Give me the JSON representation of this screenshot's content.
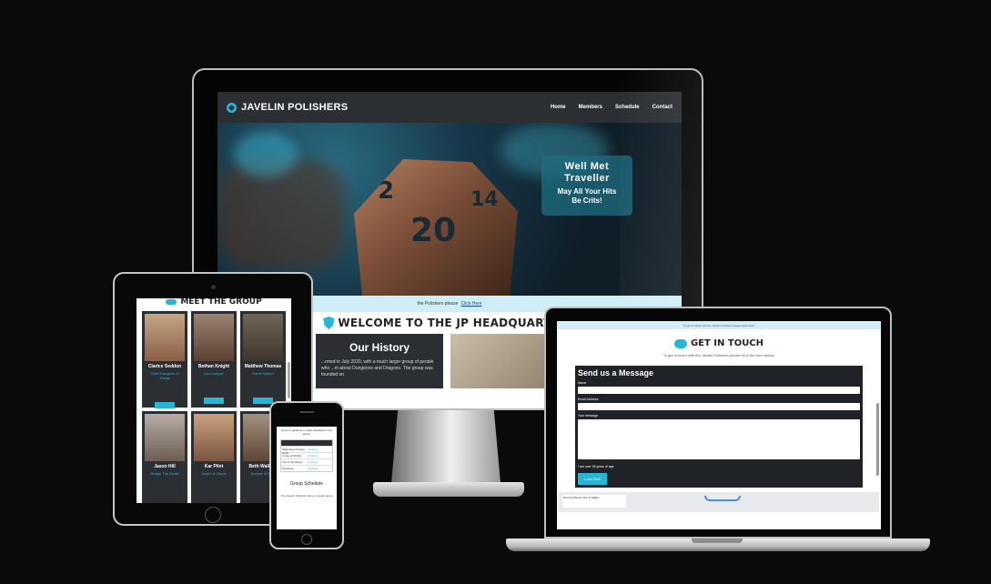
{
  "desktop": {
    "brand": "JAVELIN POLISHERS",
    "nav": [
      "Home",
      "Members",
      "Schedule",
      "Contact"
    ],
    "hero": {
      "dice_numbers": [
        "2",
        "20",
        "14"
      ],
      "callout_line1": "Well Met",
      "callout_line2": "Traveller",
      "callout_line3": "May All Your Hits",
      "callout_line4": "Be Crits!"
    },
    "info_bar": {
      "text": "the Polishers please",
      "link": "Click Here"
    },
    "welcome_title": "WELCOME TO THE JP HEADQUARTERS",
    "history": {
      "title": "Our History",
      "text": "...rmed in July 2020, with a much larger group of people who ...m about Dungeons and Dragons. The group was founded on"
    }
  },
  "tablet": {
    "title": "MEET THE GROUP",
    "members": [
      {
        "name": "Clarice Seddon",
        "role": "Chief Dungeon of Things"
      },
      {
        "name": "Bethan Knight",
        "role": "Lore Keeper"
      },
      {
        "name": "Matthew Thomas",
        "role": "Game Master"
      },
      {
        "name": "Jason Hill",
        "role": "Rogue The Beast"
      },
      {
        "name": "Kar Pilot",
        "role": "Squid of Chaos"
      },
      {
        "name": "Beth Wallace",
        "role": "Keeper of Dice"
      }
    ]
  },
  "phone": {
    "intro": "Here's a guide as to what schedule for the group.",
    "rows": [
      {
        "campaign": "Waterdeep Dragon Heist",
        "status": "Ongoing"
      },
      {
        "campaign": "Curse of Strahd",
        "status": "Ongoing"
      },
      {
        "campaign": "Out of the Abyss",
        "status": "Ongoing"
      },
      {
        "campaign": "Oneshots",
        "status": "Ongoing"
      }
    ],
    "schedule_title": "Group Schedule",
    "footer": "The Javelin Polishers have a regular group"
  },
  "laptop": {
    "top_bar": "To get in touch with the Javelin Polishers please Click Here",
    "title": "GET IN TOUCH",
    "subtitle": "To get in touch with the Javelin Polishers please fill in the form below.",
    "form_title": "Send us a Message",
    "name_label": "Name",
    "email_label": "Email Address",
    "message_label": "Your message",
    "age_check": "I am over 18 years of age",
    "submit": "Let's Roll!",
    "map_label": "Penrhos Bowls Club & Halfbu..."
  },
  "colors": {
    "accent": "#29b6d6",
    "dark": "#2b2e33",
    "info_bar": "#cfeef7"
  }
}
